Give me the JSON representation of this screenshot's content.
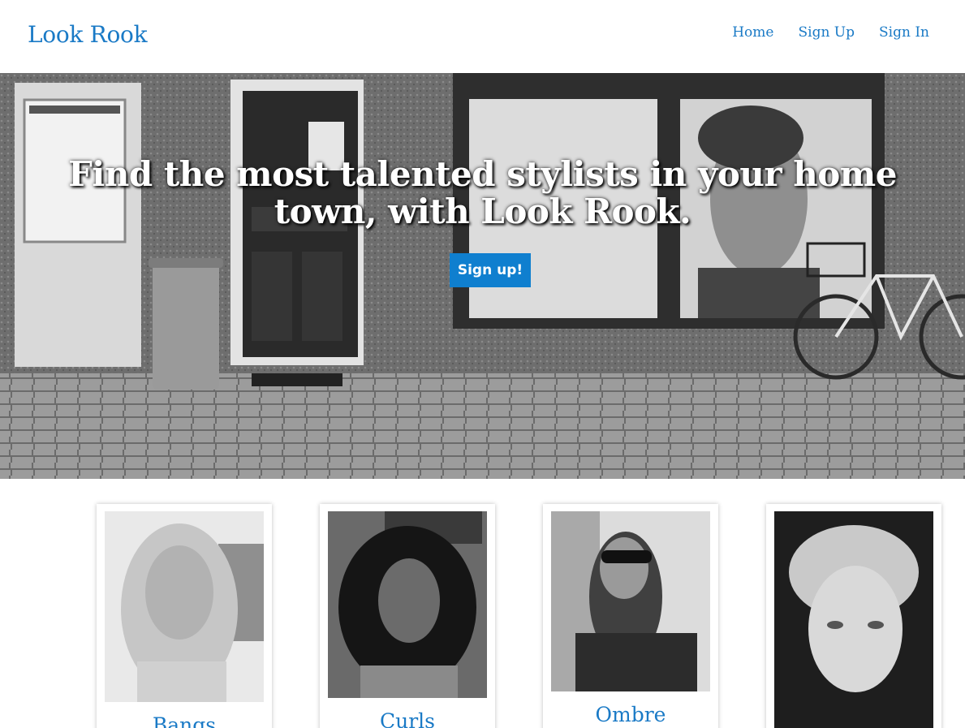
{
  "header": {
    "brand": "Look Rook",
    "nav": [
      {
        "label": "Home"
      },
      {
        "label": "Sign Up"
      },
      {
        "label": "Sign In"
      }
    ]
  },
  "hero": {
    "title": "Find the most talented stylists in your home town, with Look Rook.",
    "cta_label": "Sign up!"
  },
  "styles": [
    {
      "label": "Bangs"
    },
    {
      "label": "Curls"
    },
    {
      "label": "Ombre"
    },
    {
      "label": ""
    }
  ],
  "colors": {
    "accent": "#1a7ac6",
    "button": "#0f7fcf"
  }
}
